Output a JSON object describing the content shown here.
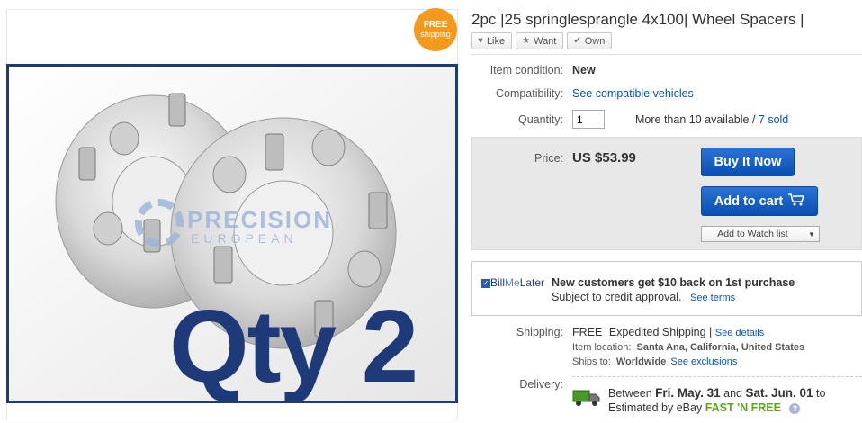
{
  "badge": {
    "line1": "FREE",
    "line2": "shipping"
  },
  "photo": {
    "overlay_text": "Qty 2",
    "watermark_line1": "PRECISION",
    "watermark_line2": "EUROPEAN"
  },
  "listing": {
    "title": "2pc |25 springlesprangle 4x100| Wheel Spacers |",
    "social": {
      "like": "Like",
      "want": "Want",
      "own": "Own"
    }
  },
  "details": {
    "condition_label": "Item condition:",
    "condition_value": "New",
    "compat_label": "Compatibility:",
    "compat_link": "See compatible vehicles",
    "qty_label": "Quantity:",
    "qty_value": "1",
    "availability": "More than 10 available / ",
    "sold_link": "7 sold"
  },
  "price": {
    "label": "Price:",
    "value": "US $53.99",
    "buy_now": "Buy It Now",
    "add_to_cart": "Add to cart",
    "watch_list": "Add to Watch list"
  },
  "billmelater": {
    "logo_bill": "Bill",
    "logo_me": "Me",
    "logo_later": "Later",
    "headline": "New customers get $10 back on 1st purchase",
    "subtext": "Subject to credit approval.",
    "terms_link": "See terms"
  },
  "shipping": {
    "label": "Shipping:",
    "free": "FREE",
    "method": "Expedited Shipping",
    "pipe": "|",
    "details_link": "See details",
    "location_label": "Item location:",
    "location_value": "Santa Ana, California, United States",
    "ships_label": "Ships to:",
    "ships_value": "Worldwide",
    "exclusions_link": "See exclusions"
  },
  "delivery": {
    "label": "Delivery:",
    "between": "Between",
    "date_from": "Fri. May. 31",
    "and": "and",
    "date_to": "Sat. Jun. 01",
    "to": "to",
    "estimated": "Estimated by eBay",
    "fast": "FAST 'N FREE",
    "help": "?"
  },
  "colors": {
    "accent_blue": "#0654ba",
    "button_blue": "#1b62c6",
    "badge_orange": "#f39a1e",
    "overlay_navy": "#1e3a78",
    "fast_green": "#5ba71b"
  }
}
